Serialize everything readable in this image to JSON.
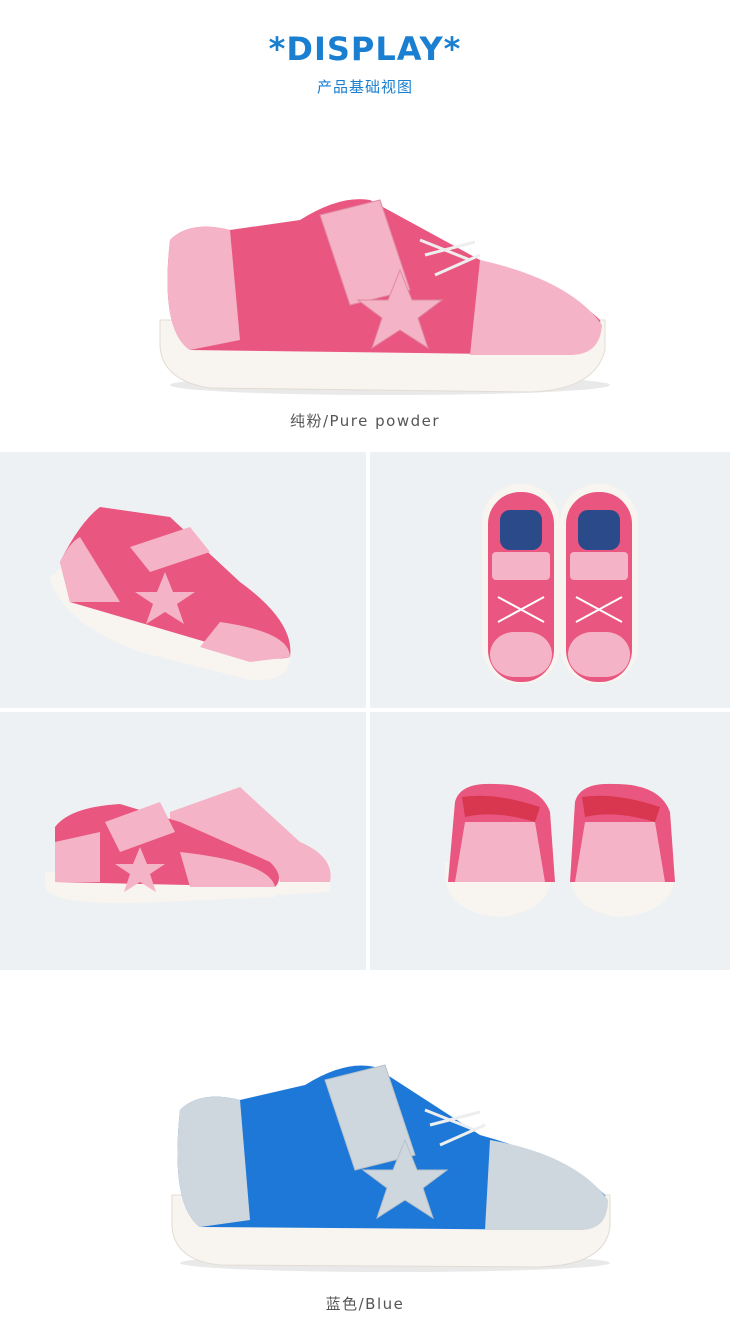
{
  "header": {
    "title": "*DISPLAY*",
    "subtitle": "产品基础视图"
  },
  "captions": {
    "pink": "纯粉/Pure powder",
    "blue": "蓝色/Blue"
  },
  "colors": {
    "accent": "#1a7fd1",
    "pink_main": "#e9567f",
    "pink_light": "#f4b3c6",
    "blue_main": "#1e78d8",
    "grey_light": "#cfd7de",
    "panel_bg": "#eef1f3"
  },
  "images": [
    {
      "name": "pink-shoe-side-view"
    },
    {
      "name": "pink-shoe-angled-view"
    },
    {
      "name": "pink-shoes-top-view"
    },
    {
      "name": "pink-shoes-front-pair-view"
    },
    {
      "name": "pink-shoes-back-view"
    },
    {
      "name": "blue-shoe-side-view"
    }
  ]
}
